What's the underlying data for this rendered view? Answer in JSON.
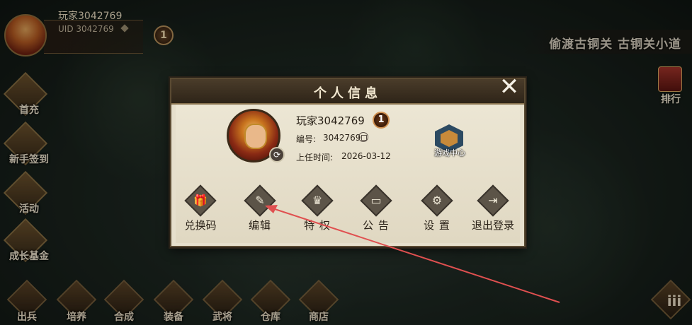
{
  "player": {
    "name": "玩家3042769",
    "uid": "UID 3042769",
    "level": "1"
  },
  "location": "偷渡古铜关  古铜关小道",
  "left_menu": [
    {
      "label": "首充",
      "icon": "gift-box-icon"
    },
    {
      "label": "新手签到",
      "icon": "calendar-icon"
    },
    {
      "label": "活动",
      "icon": "event-icon"
    },
    {
      "label": "成长基金",
      "icon": "treasure-icon"
    }
  ],
  "right_menu": {
    "rank_label": "排行",
    "rank_icon": "scroll-icon"
  },
  "bottom_nav": [
    {
      "label": "出兵",
      "icon": "troops-icon"
    },
    {
      "label": "培养",
      "icon": "cultivate-icon"
    },
    {
      "label": "合成",
      "icon": "synthesis-icon"
    },
    {
      "label": "装备",
      "icon": "equipment-icon"
    },
    {
      "label": "武将",
      "icon": "general-icon"
    },
    {
      "label": "仓库",
      "icon": "warehouse-icon"
    },
    {
      "label": "商店",
      "icon": "shop-icon"
    }
  ],
  "more_button": {
    "glyph": "iii"
  },
  "dialog": {
    "title": "个人信息",
    "close_glyph": "✕",
    "name": "玩家3042769",
    "level": "1",
    "id_label": "编号:",
    "id_value": "3042769",
    "time_label": "上任时间:",
    "time_value": "2026-03-12",
    "game_center_label": "游戏中心",
    "actions": [
      {
        "label": "兑换码",
        "icon": "gift-icon",
        "glyph": "🎁"
      },
      {
        "label": "编辑",
        "icon": "pen-icon",
        "glyph": "✎"
      },
      {
        "label": "特 权",
        "icon": "crown-icon",
        "glyph": "♛"
      },
      {
        "label": "公 告",
        "icon": "notice-icon",
        "glyph": "▭"
      },
      {
        "label": "设 置",
        "icon": "gear-icon",
        "glyph": "⚙"
      },
      {
        "label": "退出登录",
        "icon": "logout-icon",
        "glyph": "⇥"
      }
    ]
  },
  "colors": {
    "annotation_arrow": "#e05050",
    "dialog_bg": "#e6dfcc",
    "header_bg": "#3a2e20"
  }
}
